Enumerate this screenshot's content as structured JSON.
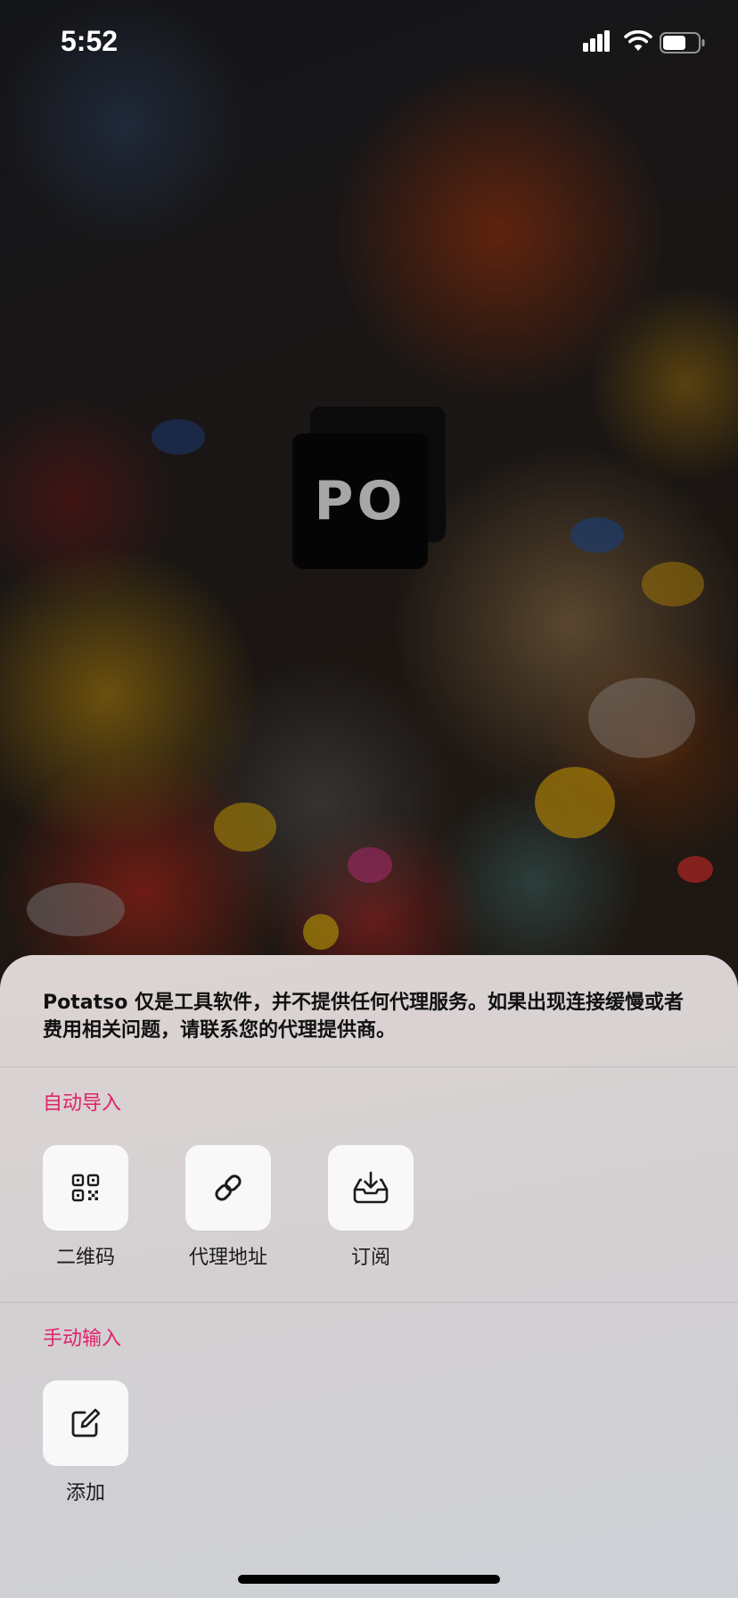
{
  "status_bar": {
    "time": "5:52",
    "icons": [
      "cellular-signal-icon",
      "wifi-icon",
      "battery-icon"
    ]
  },
  "logo": {
    "text": "PO"
  },
  "sheet": {
    "notice": "Potatso 仅是工具软件，并不提供任何代理服务。如果出现连接缓慢或者费用相关问题，请联系您的代理提供商。",
    "sections": [
      {
        "title": "自动导入",
        "items": [
          {
            "label": "二维码",
            "icon": "qr-code-icon"
          },
          {
            "label": "代理地址",
            "icon": "link-icon"
          },
          {
            "label": "订阅",
            "icon": "inbox-download-icon"
          }
        ]
      },
      {
        "title": "手动输入",
        "items": [
          {
            "label": "添加",
            "icon": "edit-icon"
          }
        ]
      }
    ]
  },
  "colors": {
    "section_title": "#e0226b",
    "tile_background": "#f8f8f9",
    "sheet_background": "#d6d2d3"
  }
}
